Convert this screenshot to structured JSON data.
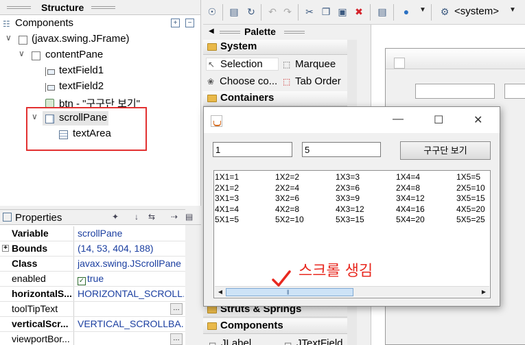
{
  "structure": {
    "title": "Structure",
    "components_label": "Components",
    "tree": [
      {
        "label": "(javax.swing.JFrame)",
        "icon": "frame-icon"
      },
      {
        "label": "contentPane",
        "icon": "panel-icon"
      },
      {
        "label": "textField1",
        "icon": "textfield-icon"
      },
      {
        "label": "textField2",
        "icon": "textfield-icon"
      },
      {
        "label": "btn - \"구구단 보기\"",
        "icon": "button-icon"
      },
      {
        "label": "scrollPane",
        "icon": "scrollpane-icon"
      },
      {
        "label": "textArea",
        "icon": "textarea-icon"
      }
    ]
  },
  "properties": {
    "title": "Properties",
    "rows": [
      {
        "key": "Variable",
        "value": "scrollPane"
      },
      {
        "key": "Bounds",
        "value": "(14, 53, 404, 188)"
      },
      {
        "key": "Class",
        "value": "javax.swing.JScrollPane"
      },
      {
        "key": "enabled",
        "value": "true"
      },
      {
        "key": "horizontalS...",
        "value": "HORIZONTAL_SCROLL..."
      },
      {
        "key": "toolTipText",
        "value": ""
      },
      {
        "key": "verticalScr...",
        "value": "VERTICAL_SCROLLBA..."
      },
      {
        "key": "viewportBor...",
        "value": ""
      }
    ]
  },
  "toolbar": {
    "system_combo": "<system>"
  },
  "palette": {
    "title": "Palette",
    "categories": {
      "system": "System",
      "containers": "Containers",
      "struts": "Struts & Springs",
      "components": "Components"
    },
    "items": {
      "selection": "Selection",
      "marquee": "Marquee",
      "choose": "Choose co...",
      "tab_order": "Tab Order",
      "jlabel": "JLabel",
      "jtextfield": "JTextField"
    }
  },
  "runtime_window": {
    "field1_value": "1",
    "field2_value": "5",
    "button_label": "구구단 보기",
    "table_rows": [
      [
        "1X1=1",
        "1X2=2",
        "1X3=3",
        "1X4=4",
        "1X5=5"
      ],
      [
        "2X1=2",
        "2X2=4",
        "2X3=6",
        "2X4=8",
        "2X5=10"
      ],
      [
        "3X1=3",
        "3X2=6",
        "3X3=9",
        "3X4=12",
        "3X5=15"
      ],
      [
        "4X1=4",
        "4X2=8",
        "4X3=12",
        "4X4=16",
        "4X5=20"
      ],
      [
        "5X1=5",
        "5X2=10",
        "5X3=15",
        "5X4=20",
        "5X5=25"
      ]
    ]
  },
  "annotation": {
    "text": "스크롤 생김",
    "color": "#e8281f"
  }
}
